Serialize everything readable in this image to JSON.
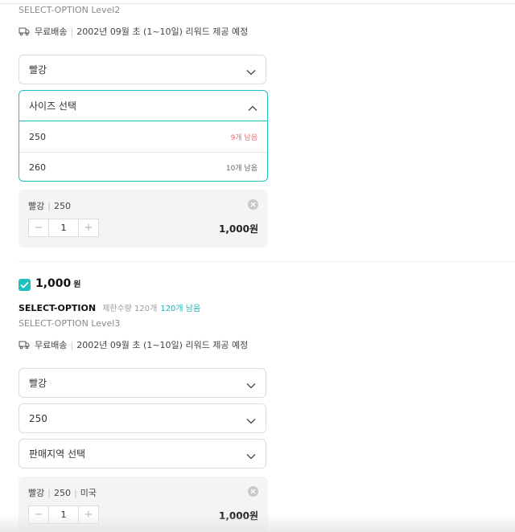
{
  "section1": {
    "level_text": "SELECT-OPTION Level2",
    "shipping": {
      "type": "무료배송",
      "schedule": "2002년 09월 초 (1~10일) 리워드 제공 예정"
    },
    "color_select": {
      "value": "빨강"
    },
    "size_dropdown": {
      "placeholder": "사이즈 선택",
      "options": [
        {
          "label": "250",
          "stock": "9개 남음"
        },
        {
          "label": "260",
          "stock": "10개 남음"
        }
      ]
    },
    "selected": {
      "color": "빨강",
      "size": "250",
      "quantity": "1",
      "price": "1,000원"
    }
  },
  "section2": {
    "price_num": "1,000",
    "price_unit": "원",
    "title": "SELECT-OPTION",
    "limit": "제한수량 120개",
    "remaining": "120개 남음",
    "level_text": "SELECT-OPTION Level3",
    "shipping": {
      "type": "무료배송",
      "schedule": "2002년 09월 초 (1~10일) 리워드 제공 예정"
    },
    "color_select": {
      "value": "빨강"
    },
    "size_select": {
      "value": "250"
    },
    "region_select": {
      "value": "판매지역 선택"
    },
    "selected": {
      "color": "빨강",
      "size": "250",
      "region": "미국",
      "quantity": "1",
      "price": "1,000원"
    }
  },
  "stepper": {
    "minus": "−",
    "plus": "+"
  },
  "colors": {
    "accent": "#1fc0c0",
    "low_stock": "#f06a6a"
  }
}
